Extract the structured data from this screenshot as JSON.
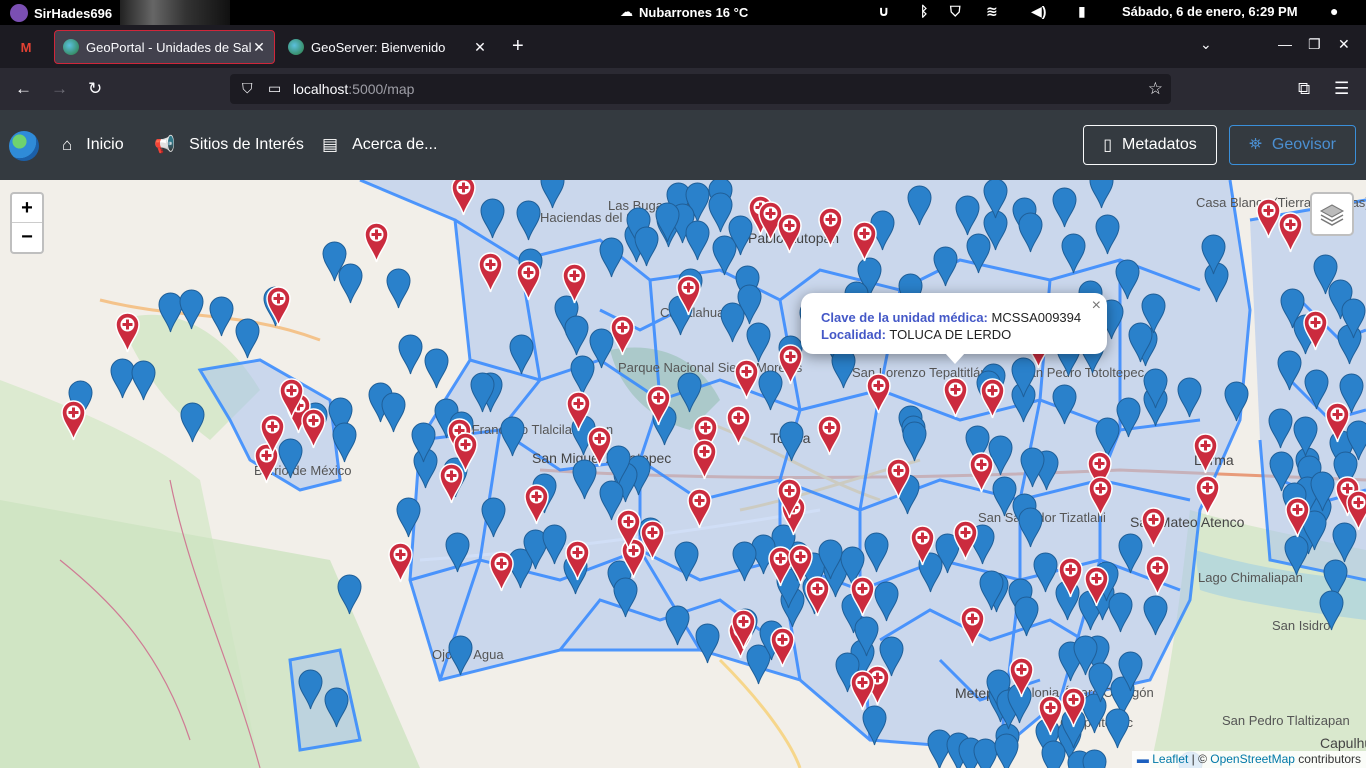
{
  "os": {
    "user": "SirHades696",
    "weather": "Nubarrones 16 °C",
    "datetime": "Sábado,  6 de enero,  6:29 PM"
  },
  "browser": {
    "tabs": [
      {
        "title": "GeoPortal - Unidades de Salud",
        "active": true
      },
      {
        "title": "GeoServer: Bienvenido",
        "active": false
      }
    ],
    "url_host": "localhost",
    "url_rest": ":5000/map"
  },
  "app": {
    "nav": {
      "home": "Inicio",
      "sites": "Sitios de Interés",
      "about": "Acerca de..."
    },
    "buttons": {
      "metadata": "Metadatos",
      "geovisor": "Geovisor"
    }
  },
  "map": {
    "popup": {
      "key_label": "Clave de la unidad médica:",
      "key_value": "MCSSA009394",
      "loc_label": "Localidad:",
      "loc_value": "TOLUCA DE LERDO"
    },
    "attribution": {
      "leaflet": "Leaflet",
      "sep": " | © ",
      "osm": "OpenStreetMap",
      "suffix": " contributors"
    },
    "labels": [
      "Pablo Autopan",
      "Toluca",
      "San Miguel Zacatepec",
      "Lerma",
      "San Mateo Atenco",
      "Calixtlahuaca",
      "Parque Nacional Sierra Morelos",
      "San Lorenzo Tepaltitlán",
      "San Pedro Totoltepec",
      "San Salvador Tizatlalli",
      "Metepec",
      "Lago Chimaliapan",
      "San Pedro Tlaltizapan",
      "Capulhuac",
      "Ojo de Agua",
      "Barrio de México",
      "Haciendas del Sol",
      "Las Bugambilias",
      "Casa Blanca (Tierras Nuevas)",
      "Colonia Álvaro Obregón",
      "San Isidro",
      "Chapultepec",
      "San Francisco Tlalcilalcalpan"
    ],
    "colors": {
      "blue_marker": "#2a81cb",
      "red_marker": "#cb2b3e",
      "polygon_stroke": "#3388ff",
      "polygon_fill": "#a9c3ee"
    }
  }
}
